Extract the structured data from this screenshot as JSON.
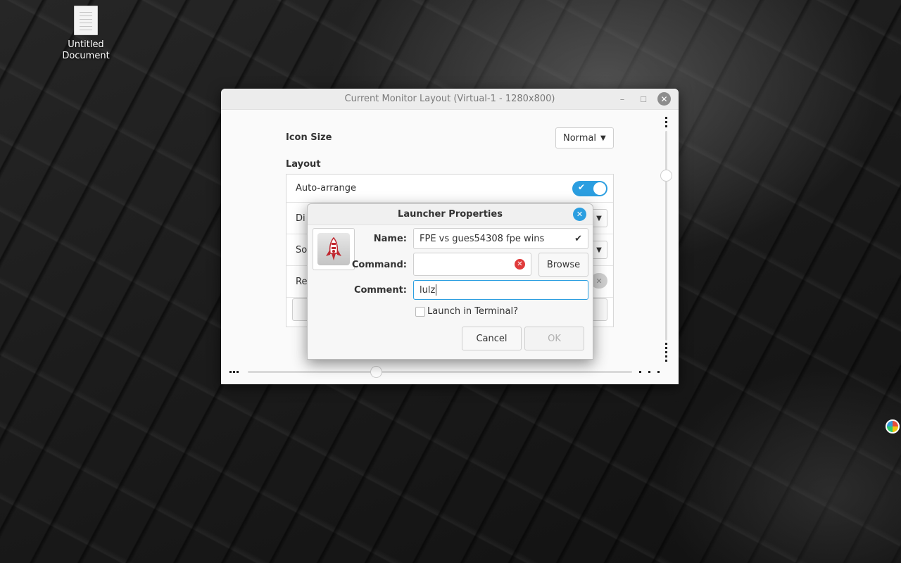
{
  "desktop": {
    "icon_label": "Untitled\nDocument",
    "icon": "document-icon",
    "tray_icon": "color-wheel-icon"
  },
  "main_window": {
    "title": "Current Monitor Layout (Virtual-1 - 1280x800)",
    "buttons": {
      "minimize": "–",
      "maximize": "☐",
      "close": "✕"
    },
    "icon_size": {
      "label": "Icon Size",
      "value": "Normal"
    },
    "layout": {
      "label": "Layout",
      "rows": [
        {
          "label": "Auto-arrange",
          "control": "toggle",
          "state": true
        },
        {
          "label": "Di",
          "control": "combo"
        },
        {
          "label": "So",
          "control": "combo"
        },
        {
          "label": "Re",
          "control": "toggle-off"
        }
      ]
    }
  },
  "dialog": {
    "title": "Launcher Properties",
    "icon": "rocket-icon",
    "name": {
      "label": "Name:",
      "value": "FPE vs gues54308 fpe wins",
      "status_icon": "checkmark-icon"
    },
    "command": {
      "label": "Command:",
      "value": "",
      "status_icon": "error-icon"
    },
    "browse_label": "Browse",
    "comment": {
      "label": "Comment:",
      "value": "lulz"
    },
    "terminal": {
      "label": "Launch in Terminal?",
      "checked": false
    },
    "cancel_label": "Cancel",
    "ok_label": "OK"
  },
  "colors": {
    "accent": "#2b9ee0",
    "error": "#e03b3b",
    "window_bg": "#fafafa"
  }
}
